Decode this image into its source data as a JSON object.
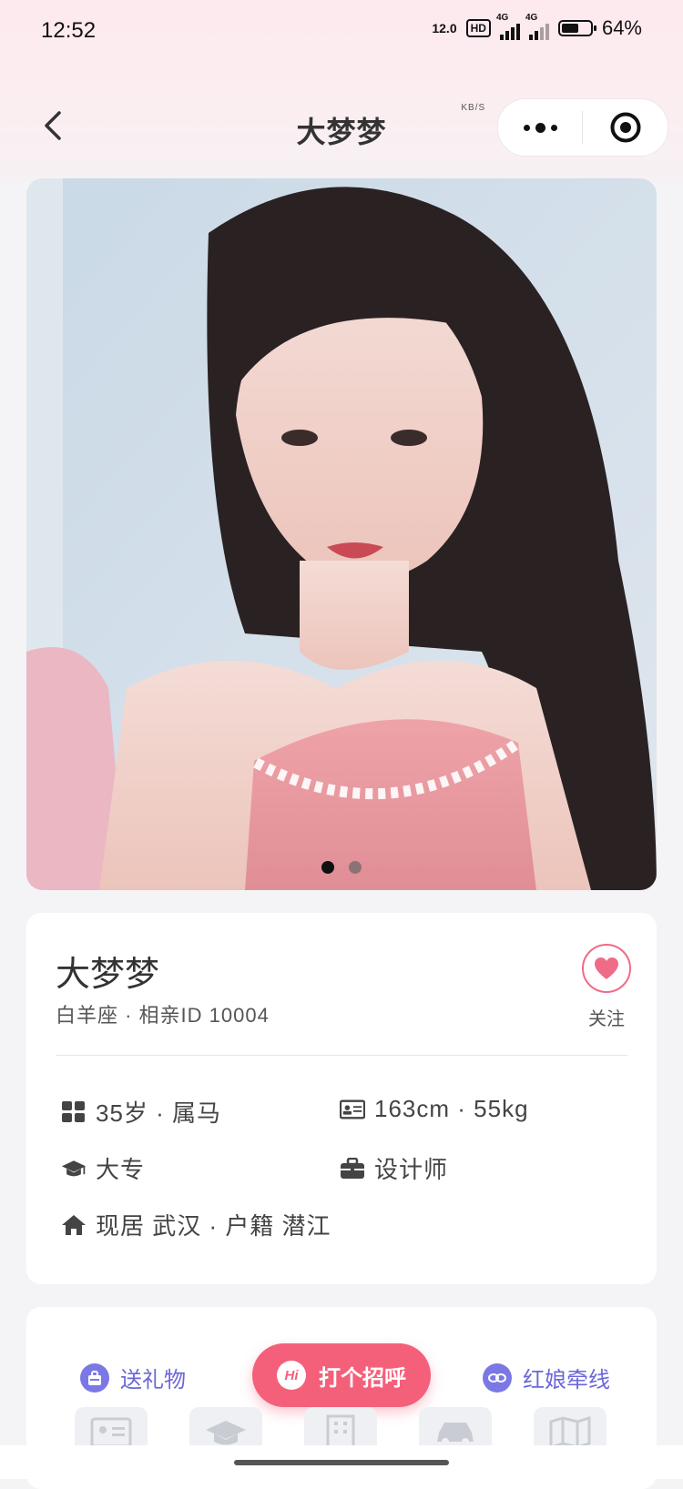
{
  "status_bar": {
    "time": "12:52",
    "net_speed": "12.0",
    "net_unit": "KB/S",
    "hd_label": "HD",
    "sim1_label": "4G",
    "sim2_label": "4G",
    "battery": "64%",
    "battery_level": 0.64
  },
  "nav": {
    "title": "大梦梦"
  },
  "photo": {
    "pages_total": 2,
    "current_page": 1
  },
  "profile": {
    "name": "大梦梦",
    "subtitle": "白羊座 · 相亲ID 10004",
    "follow_label": "关注",
    "age_zodiac": "35岁 · 属马",
    "height_weight": "163cm · 55kg",
    "education": "大专",
    "occupation": "设计师",
    "residence": "现居 武汉 · 户籍 潜江"
  },
  "actions": {
    "gift_label": "送礼物",
    "hi_badge": "Hi",
    "greet_label": "打个招呼",
    "matchmaker_label": "红娘牵线"
  },
  "icons": {
    "back": "chevron-left-icon",
    "more": "more-dots-icon",
    "close": "target-circle-icon",
    "heart": "heart-icon",
    "age": "grid-icon",
    "id_card": "id-card-icon",
    "education": "graduation-cap-icon",
    "job": "briefcase-icon",
    "home": "home-icon"
  },
  "colors": {
    "accent": "#f4607a",
    "action_purple": "#6b68d6",
    "heart": "#f06b86"
  }
}
